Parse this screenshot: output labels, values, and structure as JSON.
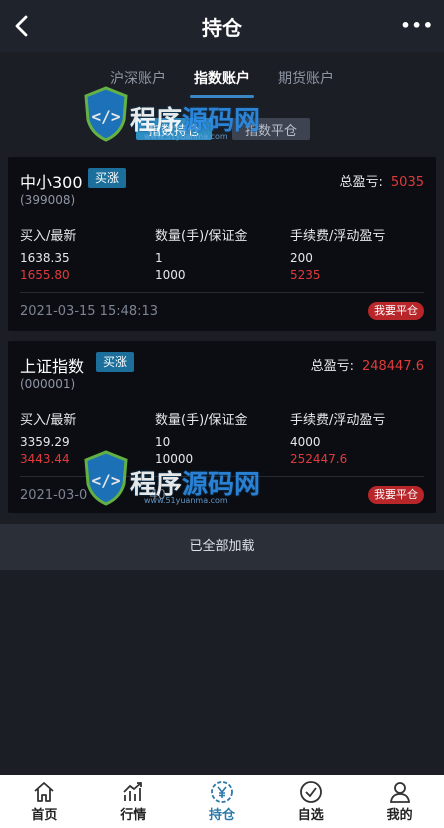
{
  "header": {
    "title": "持仓",
    "more": "•••"
  },
  "tabs": [
    {
      "label": "沪深账户",
      "active": false
    },
    {
      "label": "指数账户",
      "active": true
    },
    {
      "label": "期货账户",
      "active": false
    }
  ],
  "subtabs": {
    "positions": "指数持仓",
    "close": "指数平仓"
  },
  "watermark": {
    "text_white": "程序",
    "text_blue": "源码网",
    "url": "www.51yuanma.com"
  },
  "positions": [
    {
      "name": "中小300",
      "badge": "买涨",
      "code": "(399008)",
      "pl_label": "总盈亏:",
      "pl_value": "5035",
      "col1_header": "买入/最新",
      "col2_header": "数量(手)/保证金",
      "col3_header": "手续费/浮动盈亏",
      "buy_price": "1638.35",
      "latest_price": "1655.80",
      "lots": "1",
      "margin": "1000",
      "fee": "200",
      "floating_pl": "5235",
      "time": "2021-03-15 15:48:13",
      "close_button": "我要平仓"
    },
    {
      "name": "上证指数",
      "badge": "买涨",
      "code": "(000001)",
      "pl_label": "总盈亏:",
      "pl_value": "248447.6",
      "col1_header": "买入/最新",
      "col2_header": "数量(手)/保证金",
      "col3_header": "手续费/浮动盈亏",
      "buy_price": "3359.29",
      "latest_price": "3443.44",
      "lots": "10",
      "margin": "10000",
      "fee": "4000",
      "floating_pl": "252447.6",
      "time": "2021-03-0",
      "time_tail": "40",
      "close_button": "我要平仓"
    }
  ],
  "list_footer": "已全部加载",
  "nav": [
    {
      "label": "首页",
      "icon": "home-icon",
      "active": false
    },
    {
      "label": "行情",
      "icon": "chart-icon",
      "active": false
    },
    {
      "label": "持仓",
      "icon": "yen-coin-icon",
      "active": true
    },
    {
      "label": "自选",
      "icon": "check-circle-icon",
      "active": false
    },
    {
      "label": "我的",
      "icon": "user-icon",
      "active": false
    }
  ],
  "colors": {
    "accent": "#3a86c4",
    "loss_gain_red": "#e03b3b",
    "badge_blue": "#1c6f9a",
    "close_red": "#b8262a"
  }
}
